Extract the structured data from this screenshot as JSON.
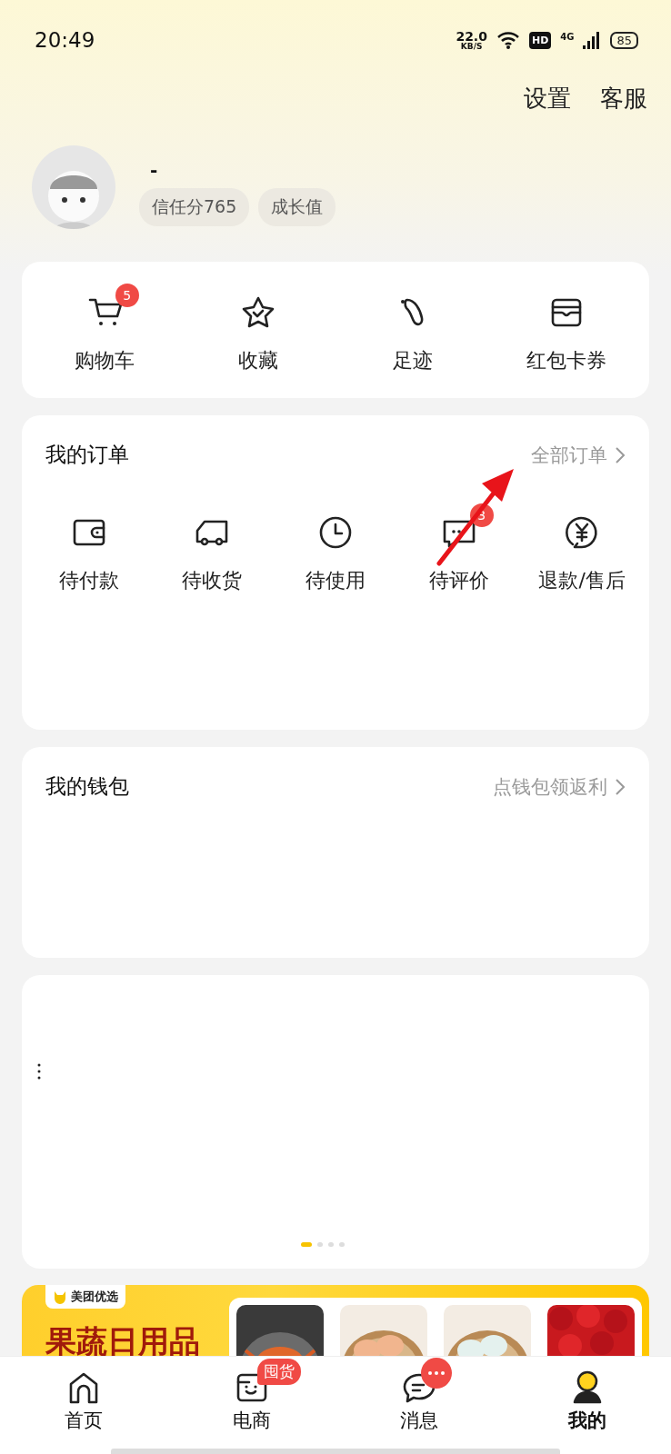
{
  "status_bar": {
    "time": "20:49",
    "speed_value": "22.0",
    "speed_unit": "KB/S",
    "hd": "HD",
    "network": "4G",
    "battery": "85"
  },
  "header_actions": [
    "设置",
    "客服"
  ],
  "profile": {
    "name": "-",
    "tags": [
      "信任分765",
      "成长值"
    ]
  },
  "shortcuts": [
    {
      "label": "购物车",
      "badge": "5"
    },
    {
      "label": "收藏"
    },
    {
      "label": "足迹"
    },
    {
      "label": "红包卡券"
    }
  ],
  "orders": {
    "title": "我的订单",
    "link": "全部订单",
    "items": [
      {
        "label": "待付款"
      },
      {
        "label": "待收货"
      },
      {
        "label": "待使用"
      },
      {
        "label": "待评价",
        "badge": "3"
      },
      {
        "label": "退款/售后"
      }
    ]
  },
  "wallet": {
    "title": "我的钱包",
    "link": "点钱包领返利"
  },
  "carousel": {
    "pages": [
      {
        "selected": true
      },
      {
        "selected": false
      },
      {
        "selected": false
      },
      {
        "selected": false
      }
    ]
  },
  "banner": {
    "brand": "美团优选",
    "title": "果蔬日用品"
  },
  "tab_bar": [
    {
      "label": "首页",
      "selected": false
    },
    {
      "label": "电商",
      "badge": "囤货",
      "selected": false
    },
    {
      "label": "消息",
      "dot_badge": true,
      "selected": false
    },
    {
      "label": "我的",
      "selected": true
    }
  ],
  "annotations": [
    {
      "kind": "arrow"
    }
  ]
}
